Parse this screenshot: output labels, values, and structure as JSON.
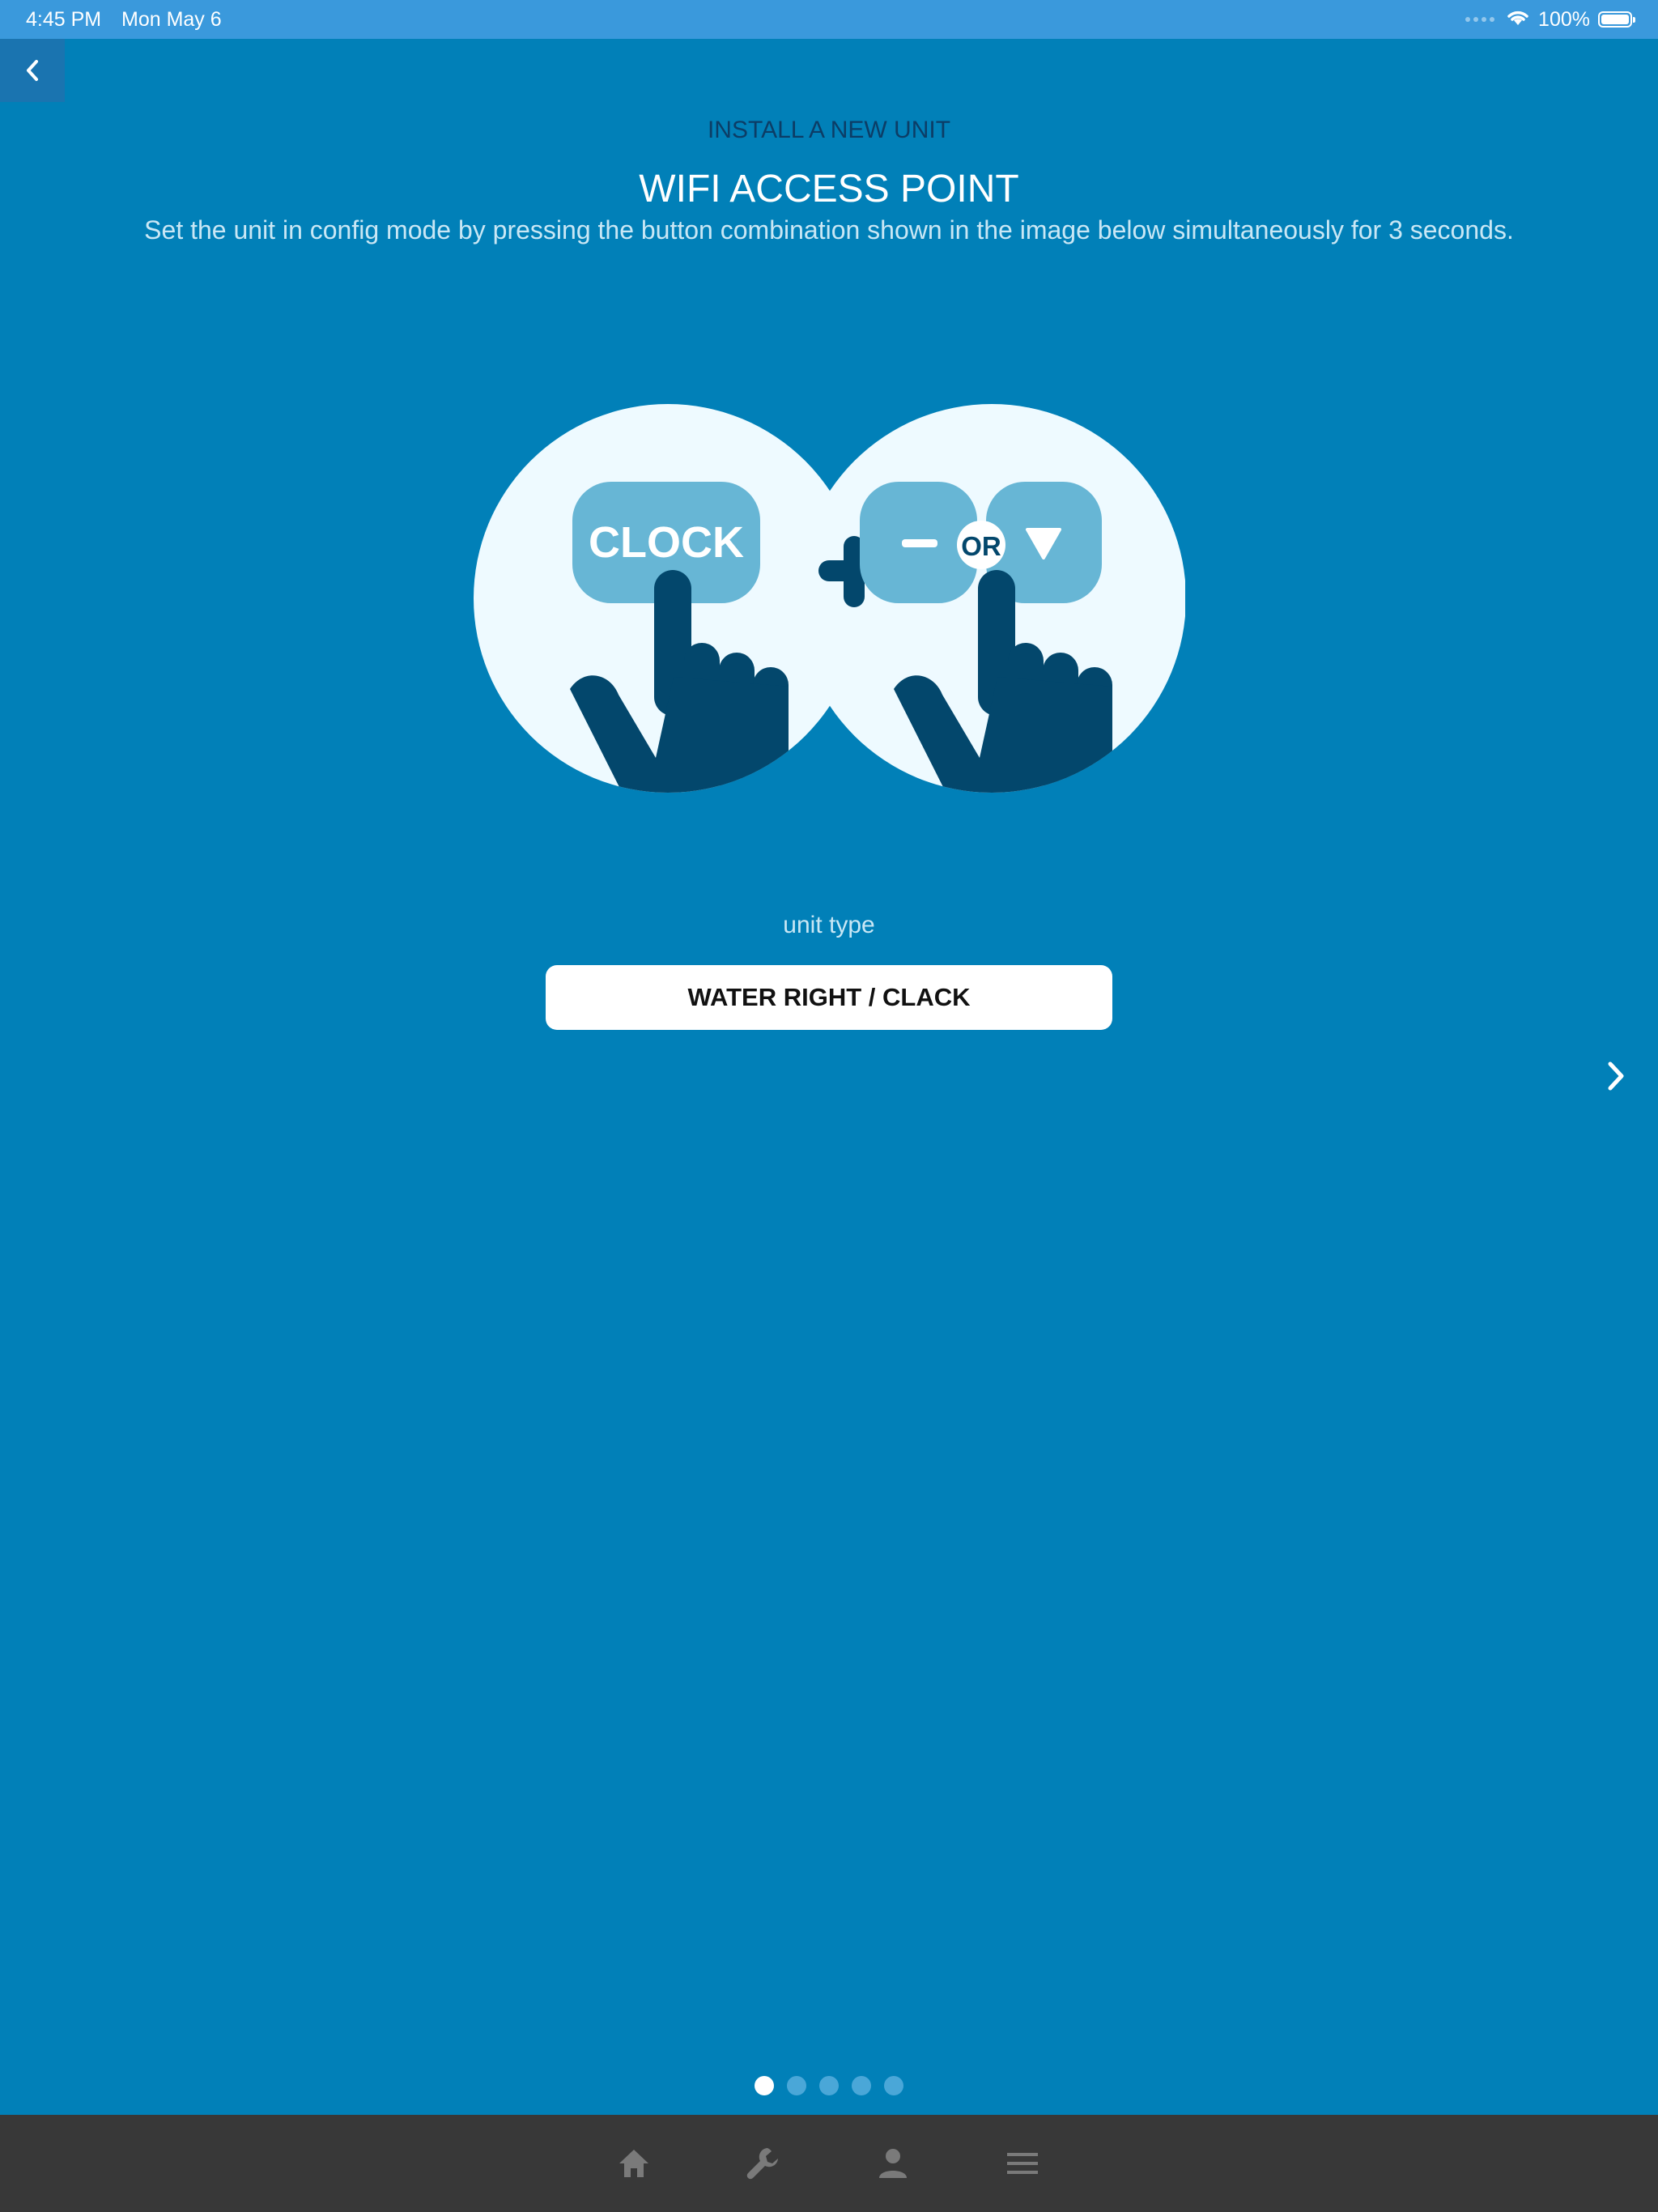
{
  "status_bar": {
    "time": "4:45 PM",
    "date": "Mon May 6",
    "battery": "100%"
  },
  "header": {
    "overline": "INSTALL A NEW UNIT",
    "title": "WIFI ACCESS POINT",
    "instructions": "Set the unit in config mode by pressing the button combination shown in the image below simultaneously for 3 seconds."
  },
  "illustration": {
    "button_1": "CLOCK",
    "connector": "OR"
  },
  "unit_type": {
    "label": "unit type",
    "selected": "WATER RIGHT / CLACK"
  },
  "pager": {
    "total": 5,
    "active_index": 0
  },
  "tab_bar": {
    "icons": [
      "home-icon",
      "wrench-icon",
      "person-icon",
      "menu-icon"
    ]
  },
  "colors": {
    "background": "#0180b8",
    "status_bar": "#3a99dc",
    "tab_bar": "#383838",
    "illustration_circle": "#eefaff",
    "button_fill": "#67b6d5",
    "hand": "#03476c"
  }
}
